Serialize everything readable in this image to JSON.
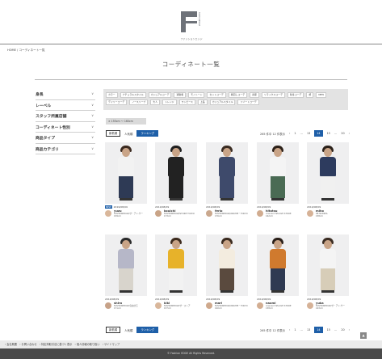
{
  "header": {
    "logo_side_text": "FASHIONEDGE",
    "logo_sub": "ファッションエッジ"
  },
  "breadcrumb": "HOME / コーディネート一覧",
  "page_title": "コーディネート一覧",
  "sidebar": {
    "items": [
      {
        "label": "身長"
      },
      {
        "label": "レーベル"
      },
      {
        "label": "スタッフ所属店舗"
      },
      {
        "label": "コーディネート性別"
      },
      {
        "label": "商品タイプ"
      },
      {
        "label": "商品カテゴリ"
      }
    ]
  },
  "tags": {
    "row1": [
      "カラー",
      "ナチュラルスタイル",
      "カジュアルコーデ",
      "通勤着",
      "モノトーン",
      "セットコーデ",
      "着回しコーデ",
      "春夏",
      "リラックスコーデ",
      "秋冬コーデ",
      "旅",
      "NEW"
    ],
    "row2": [
      "デイリーコーデ",
      "ノースリーブ",
      "大人",
      "トレンド",
      "ワンピース",
      "上品",
      "カジュアルスタイル",
      "リゾートコーデ"
    ]
  },
  "filter_chip": "× 155cm ～ 160cm",
  "controls": {
    "btn_new": "新着順",
    "btn_popular": "人気順",
    "btn_ranking": "ランキング"
  },
  "pager": {
    "summary": "265 件中 12 件表示",
    "prev": "‹",
    "pages": [
      "1",
      "…",
      "13",
      "14",
      "15",
      "…",
      "20"
    ],
    "current": "14",
    "next": "›"
  },
  "cards": [
    {
      "badge": "NEW",
      "date": "2019/08/09",
      "name": "yuzu",
      "sub1": "FASHIONEDGE/ザ・アン-サー",
      "sub2": "159cm",
      "hair": "#3b2a20",
      "top": "#f2f2f2",
      "bottom": "#2e3a55",
      "avatar": "#d9b79b"
    },
    {
      "badge": "",
      "date": "2019/08/09",
      "name": "kouichi",
      "sub1": "FASHIONEDGE/STORE TOKYO",
      "sub2": "173cm",
      "hair": "#1f1f1f",
      "top": "#222",
      "bottom": "#222",
      "avatar": "#c9a487"
    },
    {
      "badge": "",
      "date": "2019/08/09",
      "name": "ferio",
      "sub1": "FASHIONEDGE/ANKHIE・TOKYO",
      "sub2": "176cm",
      "hair": "#3a2c22",
      "top": "#3e4a6b",
      "bottom": "#3e4a6b",
      "avatar": "#caa88e"
    },
    {
      "badge": "",
      "date": "2019/08/09",
      "name": "hitotsu",
      "sub1": "crescent SPLASH STORE",
      "sub2": "162cm",
      "hair": "#2c2018",
      "top": "#f4f4f4",
      "bottom": "#4a6b54",
      "avatar": "#d1ac90"
    },
    {
      "badge": "",
      "date": "2019/08/09",
      "name": "miho",
      "sub1": "SB NARIMA",
      "sub2": "158cm",
      "hair": "#2b211a",
      "top": "#2d3b5e",
      "bottom": "#f0f0f0",
      "avatar": "#d6b297"
    },
    {
      "badge": "",
      "date": "2019/08/09",
      "name": "shiro",
      "sub1": "FASHIONEDGE/自由が丘",
      "sub2": "171cm",
      "hair": "#2a2a2a",
      "top": "#b6b7c8",
      "bottom": "#d8d4cc",
      "avatar": "#c7a288"
    },
    {
      "badge": "",
      "date": "2019/08/09",
      "name": "kiki",
      "sub1": "FASHIONEDGE/ザ・ストア",
      "sub2": "157cm",
      "hair": "#3d2b1e",
      "top": "#e7b22a",
      "bottom": "#f2f2f2",
      "avatar": "#d9b79b"
    },
    {
      "badge": "",
      "date": "2019/08/09",
      "name": "mari",
      "sub1": "FASHIONEDGE/ANKHIE・TOKYO",
      "sub2": "160cm",
      "hair": "#3a2a1f",
      "top": "#f3ecdf",
      "bottom": "#5a4a3e",
      "avatar": "#cfa98d"
    },
    {
      "badge": "",
      "date": "2019/08/09",
      "name": "naomi",
      "sub1": "crescent SPLASH STORE",
      "sub2": "158cm",
      "hair": "#2a1f18",
      "top": "#d07a2e",
      "bottom": "#2f3a52",
      "avatar": "#d3ae92"
    },
    {
      "badge": "",
      "date": "2019/08/09",
      "name": "yuka",
      "sub1": "FASHIONEDGE/ザ・アン-サー",
      "sub2": "163cm",
      "hair": "#3a2c22",
      "top": "#f4f4f4",
      "bottom": "#d7cdb8",
      "avatar": "#d6b297"
    }
  ],
  "bottom_links": "› 会社概要　› お問い合わせ　› 特定商取引法に基づく表示　› 個人情報の取り扱い　› サイトマップ",
  "footer": "© Fashion EDGE All Rights Reserved.",
  "scroll_top": "▲"
}
